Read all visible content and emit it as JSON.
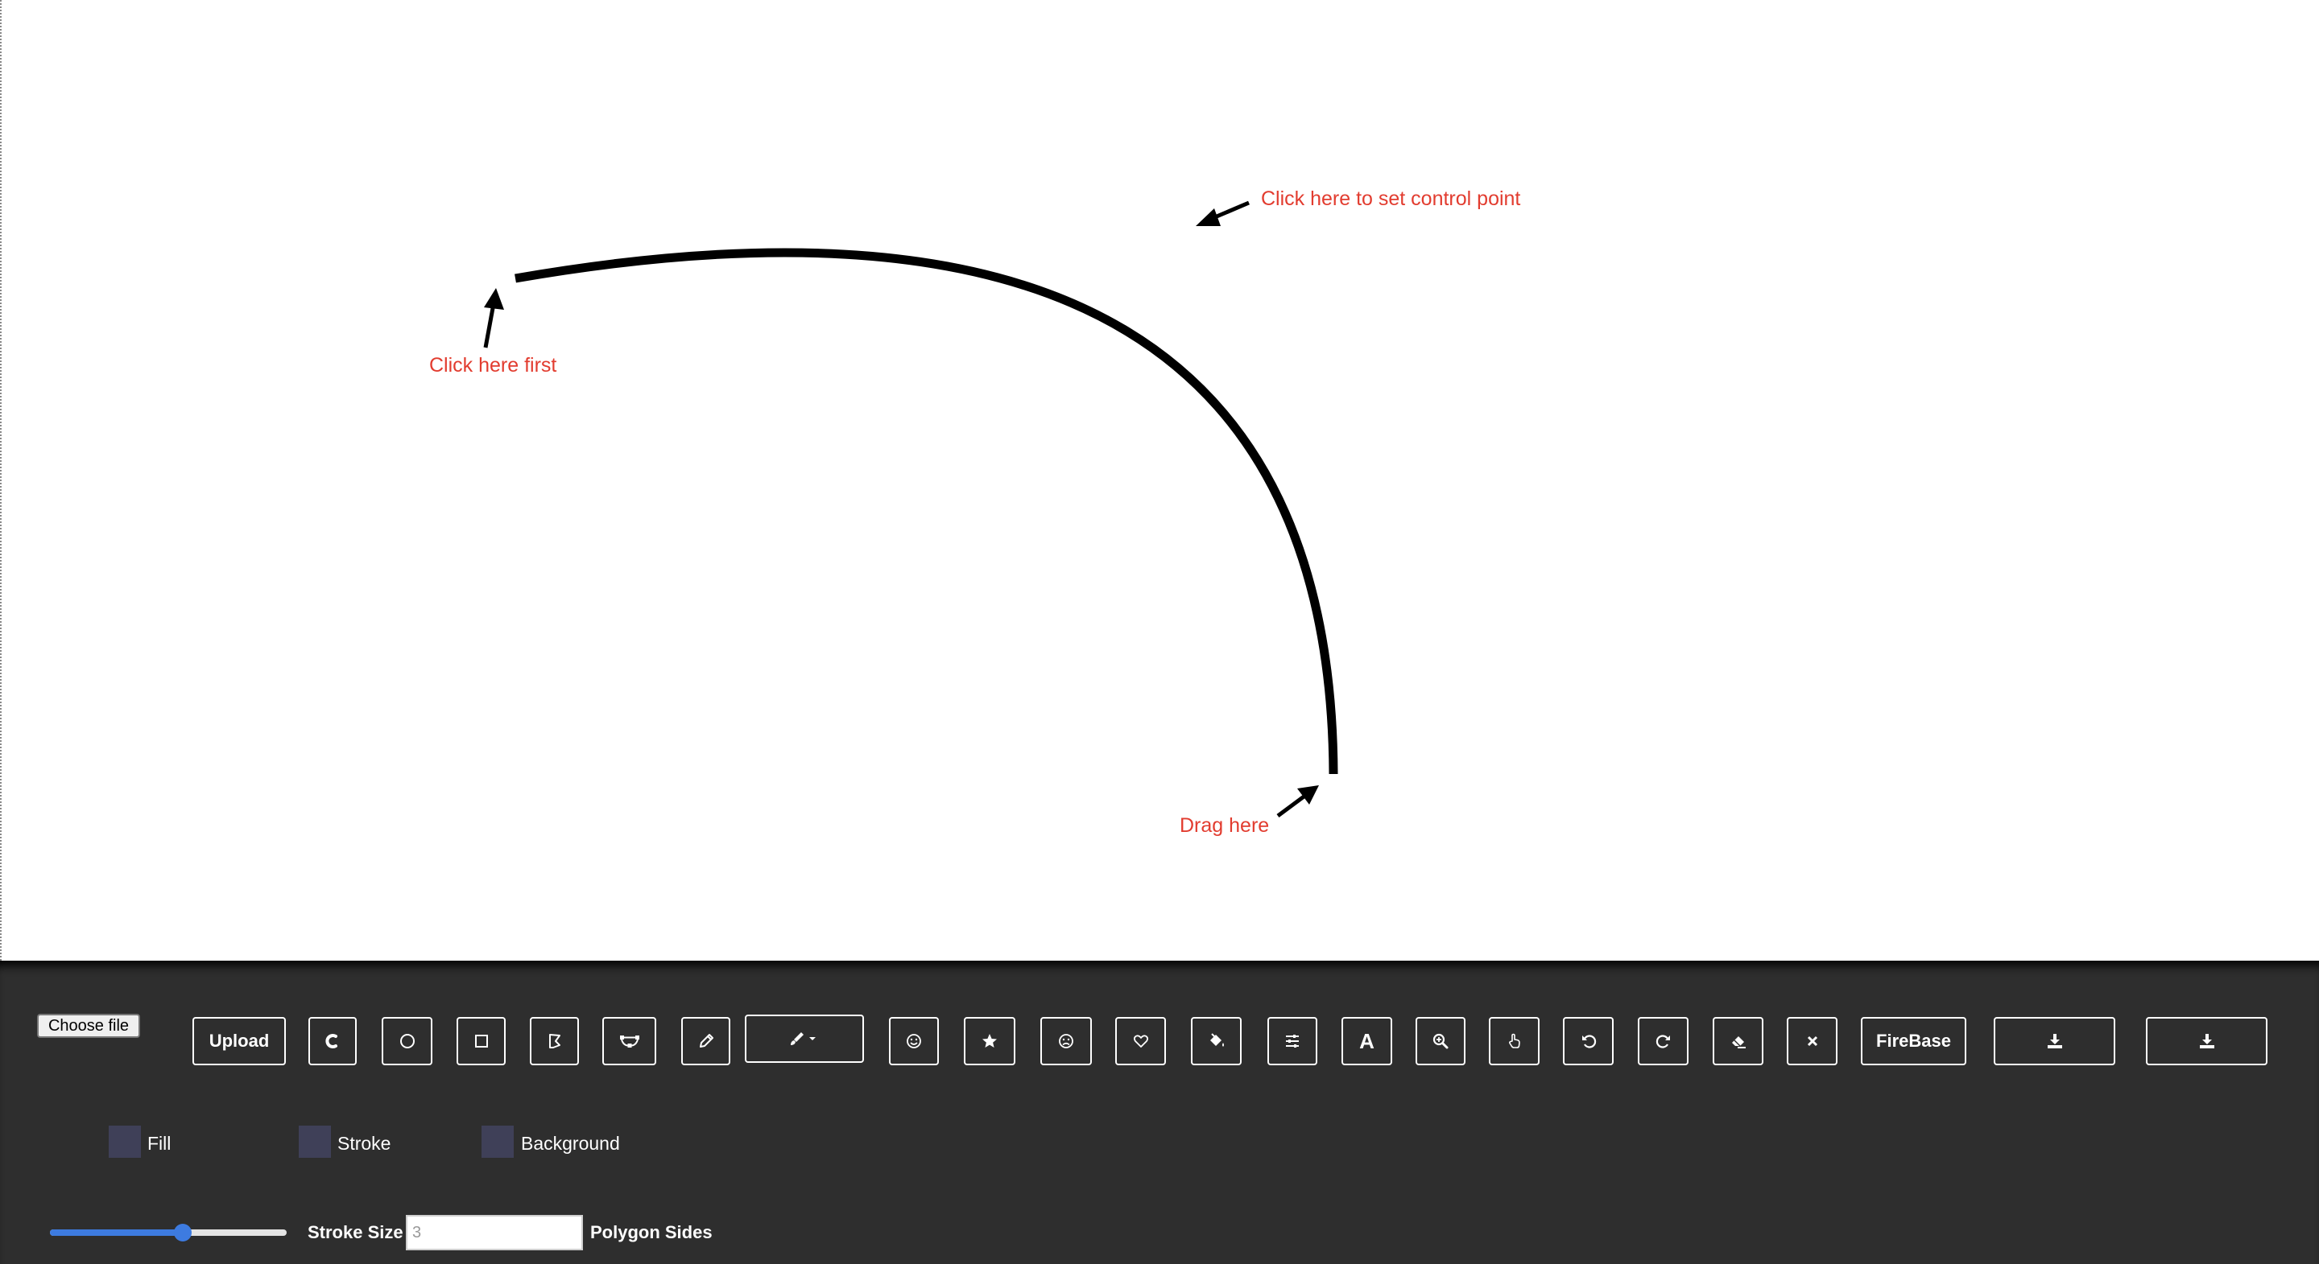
{
  "canvas": {
    "annotations": {
      "first": "Click here first",
      "control": "Click here to set control point",
      "drag": "Drag here"
    },
    "colors": {
      "annotation": "#e23c2f",
      "curve": "#000000"
    }
  },
  "toolbar": {
    "file_button": "Choose file",
    "upload_button": "Upload",
    "firebase_button": "FireBase",
    "tools": [
      {
        "icon": "curve-tool-icon"
      },
      {
        "icon": "circle-icon"
      },
      {
        "icon": "square-icon"
      },
      {
        "icon": "polygon-icon"
      },
      {
        "icon": "bezier-nodes-icon"
      },
      {
        "icon": "pencil-icon"
      },
      {
        "icon": "brush-dropdown-icon"
      },
      {
        "icon": "smiley-icon"
      },
      {
        "icon": "star-icon"
      },
      {
        "icon": "sad-face-icon"
      },
      {
        "icon": "heart-icon"
      },
      {
        "icon": "fill-bucket-icon"
      },
      {
        "icon": "sliders-icon"
      },
      {
        "icon": "text-icon"
      },
      {
        "icon": "zoom-in-icon"
      },
      {
        "icon": "hand-pointer-icon"
      },
      {
        "icon": "undo-icon"
      },
      {
        "icon": "redo-icon"
      },
      {
        "icon": "eraser-icon"
      },
      {
        "icon": "clear-icon"
      },
      {
        "icon": "download-icon"
      },
      {
        "icon": "download-icon"
      }
    ],
    "colors": {
      "background": "#2e2e2e",
      "swatch": "#3f4058",
      "slider_accent": "#3d7be0"
    }
  },
  "color_pickers": {
    "fill_label": "Fill",
    "stroke_label": "Stroke",
    "background_label": "Background"
  },
  "stroke": {
    "label": "Stroke Size",
    "level": 0.56
  },
  "polygon": {
    "placeholder": "3",
    "label": "Polygon Sides"
  }
}
